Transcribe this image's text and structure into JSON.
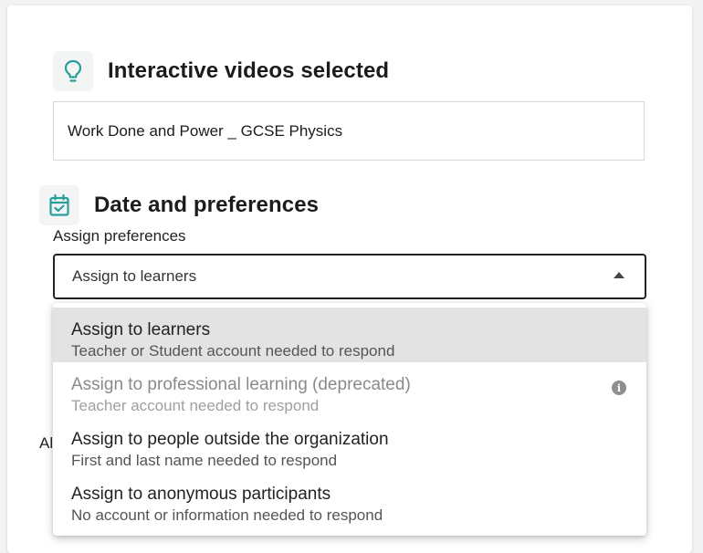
{
  "videos_section": {
    "title": "Interactive videos selected",
    "icon": "lightbulb-icon",
    "selected_video": "Work Done and Power _ GCSE Physics"
  },
  "date_section": {
    "title": "Date and preferences",
    "icon": "calendar-check-icon",
    "assign_label": "Assign preferences",
    "selected_value": "Assign to learners",
    "partially_hidden_text": "Al"
  },
  "dropdown": {
    "options": [
      {
        "title": "Assign to learners",
        "subtitle": "Teacher or Student account needed to respond",
        "selected": true,
        "disabled": false
      },
      {
        "title": "Assign to professional learning (deprecated)",
        "subtitle": "Teacher account needed to respond",
        "selected": false,
        "disabled": true,
        "info_icon": "i"
      },
      {
        "title": "Assign to people outside the organization",
        "subtitle": "First and last name needed to respond",
        "selected": false,
        "disabled": false
      },
      {
        "title": "Assign to anonymous participants",
        "subtitle": "No account or information needed to respond",
        "selected": false,
        "disabled": false
      }
    ]
  },
  "colors": {
    "accent_teal": "#2a9d9a",
    "selected_row": "#e3e3e3",
    "disabled_text": "#8a8a8a"
  }
}
